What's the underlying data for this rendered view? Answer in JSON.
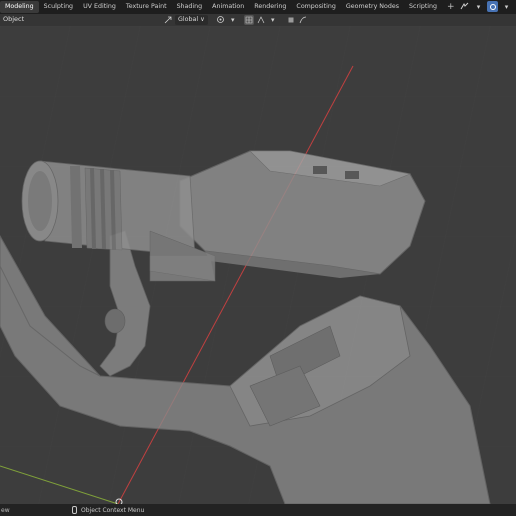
{
  "workspace_tabs": [
    "Modeling",
    "Sculpting",
    "UV Editing",
    "Texture Paint",
    "Shading",
    "Animation",
    "Rendering",
    "Compositing",
    "Geometry Nodes",
    "Scripting",
    "+"
  ],
  "active_tab_index": 0,
  "header": {
    "mode_label": "Object",
    "orientation_value": "Global",
    "orientation_arrow": "∨"
  },
  "status": {
    "left_text": "ew",
    "context_menu_label": "Object Context Menu"
  },
  "colors": {
    "background": "#3d3d3d",
    "topbar": "#1e1e1e",
    "active_tab": "#3a3a3a",
    "accent_blue": "#4772b3",
    "x_axis_red": "#c04040",
    "y_axis_green": "#7fa03a",
    "mesh_fill": "#8a8a8a"
  }
}
